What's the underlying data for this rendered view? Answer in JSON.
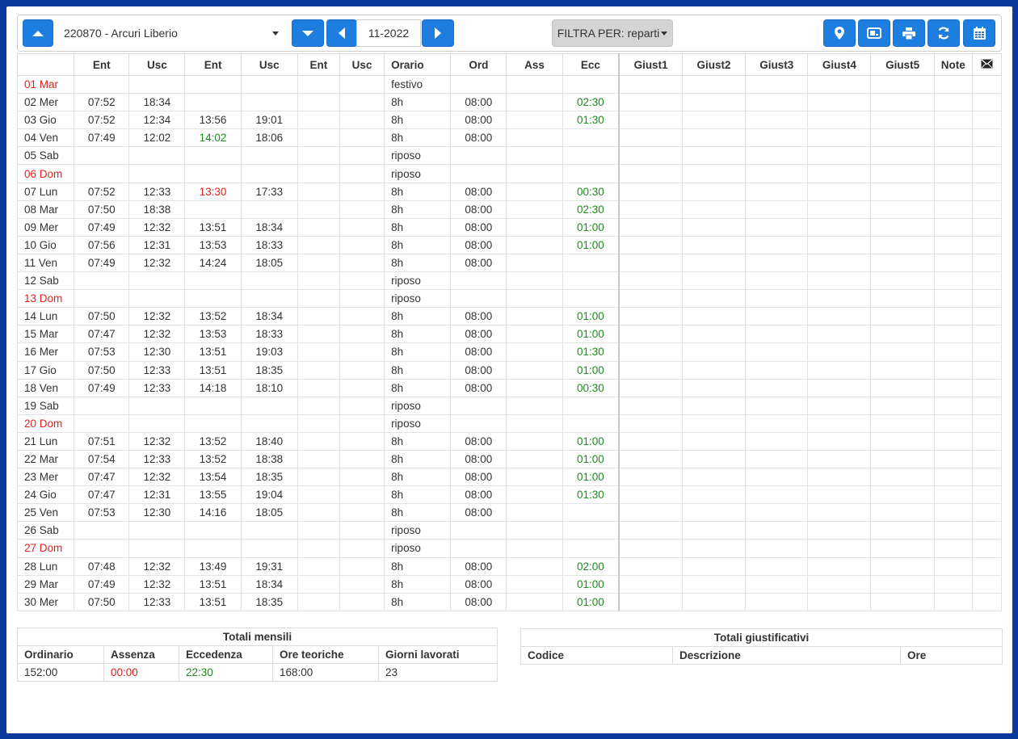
{
  "toolbar": {
    "employee": "220870 - Arcuri Liberio",
    "month": "11-2022",
    "filter_label": "FILTRA PER: reparti"
  },
  "icons": {
    "up": "arrow-up-icon",
    "down": "arrow-down-icon",
    "prev": "chevron-left-icon",
    "next": "chevron-right-icon",
    "location": "map-marker-icon",
    "badge": "badge-card-icon",
    "print": "print-icon",
    "refresh": "refresh-icon",
    "calendar": "calendar-icon",
    "mail": "envelope-icon"
  },
  "colors": {
    "accent": "#1e7ee0",
    "holiday": "#e0231c",
    "excess": "#1f8a1f",
    "frame": "#0b3a9c"
  },
  "table": {
    "headers": {
      "day": "",
      "ent1": "Ent",
      "usc1": "Usc",
      "ent2": "Ent",
      "usc2": "Usc",
      "ent3": "Ent",
      "usc3": "Usc",
      "orario": "Orario",
      "ord": "Ord",
      "ass": "Ass",
      "ecc": "Ecc",
      "g1": "Giust1",
      "g2": "Giust2",
      "g3": "Giust3",
      "g4": "Giust4",
      "g5": "Giust5",
      "note": "Note"
    },
    "rows": [
      {
        "day": "01 Mar",
        "red": true,
        "e1": "",
        "u1": "",
        "e2": "",
        "u2": "",
        "orario": "festivo",
        "ord": "",
        "ecc": ""
      },
      {
        "day": "02 Mer",
        "e1": "07:52",
        "u1": "18:34",
        "e2": "",
        "u2": "",
        "orario": "8h",
        "ord": "08:00",
        "ecc": "02:30"
      },
      {
        "day": "03 Gio",
        "e1": "07:52",
        "u1": "12:34",
        "e2": "13:56",
        "u2": "19:01",
        "orario": "8h",
        "ord": "08:00",
        "ecc": "01:30"
      },
      {
        "day": "04 Ven",
        "e1": "07:49",
        "u1": "12:02",
        "e2": "14:02",
        "e2c": "green",
        "u2": "18:06",
        "orario": "8h",
        "ord": "08:00",
        "ecc": ""
      },
      {
        "day": "05 Sab",
        "e1": "",
        "u1": "",
        "e2": "",
        "u2": "",
        "orario": "riposo",
        "ord": "",
        "ecc": ""
      },
      {
        "day": "06 Dom",
        "red": true,
        "e1": "",
        "u1": "",
        "e2": "",
        "u2": "",
        "orario": "riposo",
        "ord": "",
        "ecc": ""
      },
      {
        "day": "07 Lun",
        "e1": "07:52",
        "u1": "12:33",
        "e2": "13:30",
        "e2c": "red",
        "u2": "17:33",
        "orario": "8h",
        "ord": "08:00",
        "ecc": "00:30"
      },
      {
        "day": "08 Mar",
        "e1": "07:50",
        "u1": "18:38",
        "e2": "",
        "u2": "",
        "orario": "8h",
        "ord": "08:00",
        "ecc": "02:30"
      },
      {
        "day": "09 Mer",
        "e1": "07:49",
        "u1": "12:32",
        "e2": "13:51",
        "u2": "18:34",
        "orario": "8h",
        "ord": "08:00",
        "ecc": "01:00"
      },
      {
        "day": "10 Gio",
        "e1": "07:56",
        "u1": "12:31",
        "e2": "13:53",
        "u2": "18:33",
        "orario": "8h",
        "ord": "08:00",
        "ecc": "01:00"
      },
      {
        "day": "11 Ven",
        "e1": "07:49",
        "u1": "12:32",
        "e2": "14:24",
        "u2": "18:05",
        "orario": "8h",
        "ord": "08:00",
        "ecc": ""
      },
      {
        "day": "12 Sab",
        "e1": "",
        "u1": "",
        "e2": "",
        "u2": "",
        "orario": "riposo",
        "ord": "",
        "ecc": ""
      },
      {
        "day": "13 Dom",
        "red": true,
        "e1": "",
        "u1": "",
        "e2": "",
        "u2": "",
        "orario": "riposo",
        "ord": "",
        "ecc": ""
      },
      {
        "day": "14 Lun",
        "e1": "07:50",
        "u1": "12:32",
        "e2": "13:52",
        "u2": "18:34",
        "orario": "8h",
        "ord": "08:00",
        "ecc": "01:00"
      },
      {
        "day": "15 Mar",
        "e1": "07:47",
        "u1": "12:32",
        "e2": "13:53",
        "u2": "18:33",
        "orario": "8h",
        "ord": "08:00",
        "ecc": "01:00"
      },
      {
        "day": "16 Mer",
        "e1": "07:53",
        "u1": "12:30",
        "e2": "13:51",
        "u2": "19:03",
        "orario": "8h",
        "ord": "08:00",
        "ecc": "01:30"
      },
      {
        "day": "17 Gio",
        "e1": "07:50",
        "u1": "12:33",
        "e2": "13:51",
        "u2": "18:35",
        "orario": "8h",
        "ord": "08:00",
        "ecc": "01:00"
      },
      {
        "day": "18 Ven",
        "e1": "07:49",
        "u1": "12:33",
        "e2": "14:18",
        "u2": "18:10",
        "orario": "8h",
        "ord": "08:00",
        "ecc": "00:30"
      },
      {
        "day": "19 Sab",
        "e1": "",
        "u1": "",
        "e2": "",
        "u2": "",
        "orario": "riposo",
        "ord": "",
        "ecc": ""
      },
      {
        "day": "20 Dom",
        "red": true,
        "e1": "",
        "u1": "",
        "e2": "",
        "u2": "",
        "orario": "riposo",
        "ord": "",
        "ecc": ""
      },
      {
        "day": "21 Lun",
        "e1": "07:51",
        "u1": "12:32",
        "e2": "13:52",
        "u2": "18:40",
        "orario": "8h",
        "ord": "08:00",
        "ecc": "01:00"
      },
      {
        "day": "22 Mar",
        "e1": "07:54",
        "u1": "12:33",
        "e2": "13:52",
        "u2": "18:38",
        "orario": "8h",
        "ord": "08:00",
        "ecc": "01:00"
      },
      {
        "day": "23 Mer",
        "e1": "07:47",
        "u1": "12:32",
        "e2": "13:54",
        "u2": "18:35",
        "orario": "8h",
        "ord": "08:00",
        "ecc": "01:00"
      },
      {
        "day": "24 Gio",
        "e1": "07:47",
        "u1": "12:31",
        "e2": "13:55",
        "u2": "19:04",
        "orario": "8h",
        "ord": "08:00",
        "ecc": "01:30"
      },
      {
        "day": "25 Ven",
        "e1": "07:53",
        "u1": "12:30",
        "e2": "14:16",
        "u2": "18:05",
        "orario": "8h",
        "ord": "08:00",
        "ecc": ""
      },
      {
        "day": "26 Sab",
        "e1": "",
        "u1": "",
        "e2": "",
        "u2": "",
        "orario": "riposo",
        "ord": "",
        "ecc": ""
      },
      {
        "day": "27 Dom",
        "red": true,
        "e1": "",
        "u1": "",
        "e2": "",
        "u2": "",
        "orario": "riposo",
        "ord": "",
        "ecc": ""
      },
      {
        "day": "28 Lun",
        "e1": "07:48",
        "u1": "12:32",
        "e2": "13:49",
        "u2": "19:31",
        "orario": "8h",
        "ord": "08:00",
        "ecc": "02:00"
      },
      {
        "day": "29 Mar",
        "e1": "07:49",
        "u1": "12:32",
        "e2": "13:51",
        "u2": "18:34",
        "orario": "8h",
        "ord": "08:00",
        "ecc": "01:00"
      },
      {
        "day": "30 Mer",
        "e1": "07:50",
        "u1": "12:33",
        "e2": "13:51",
        "u2": "18:35",
        "orario": "8h",
        "ord": "08:00",
        "ecc": "01:00"
      }
    ]
  },
  "totali_mensili": {
    "title": "Totali mensili",
    "headers": [
      "Ordinario",
      "Assenza",
      "Eccedenza",
      "Ore teoriche",
      "Giorni lavorati"
    ],
    "values": [
      "152:00",
      "00:00",
      "22:30",
      "168:00",
      "23"
    ]
  },
  "totali_giustificativi": {
    "title": "Totali giustificativi",
    "headers": [
      "Codice",
      "Descrizione",
      "Ore"
    ]
  }
}
